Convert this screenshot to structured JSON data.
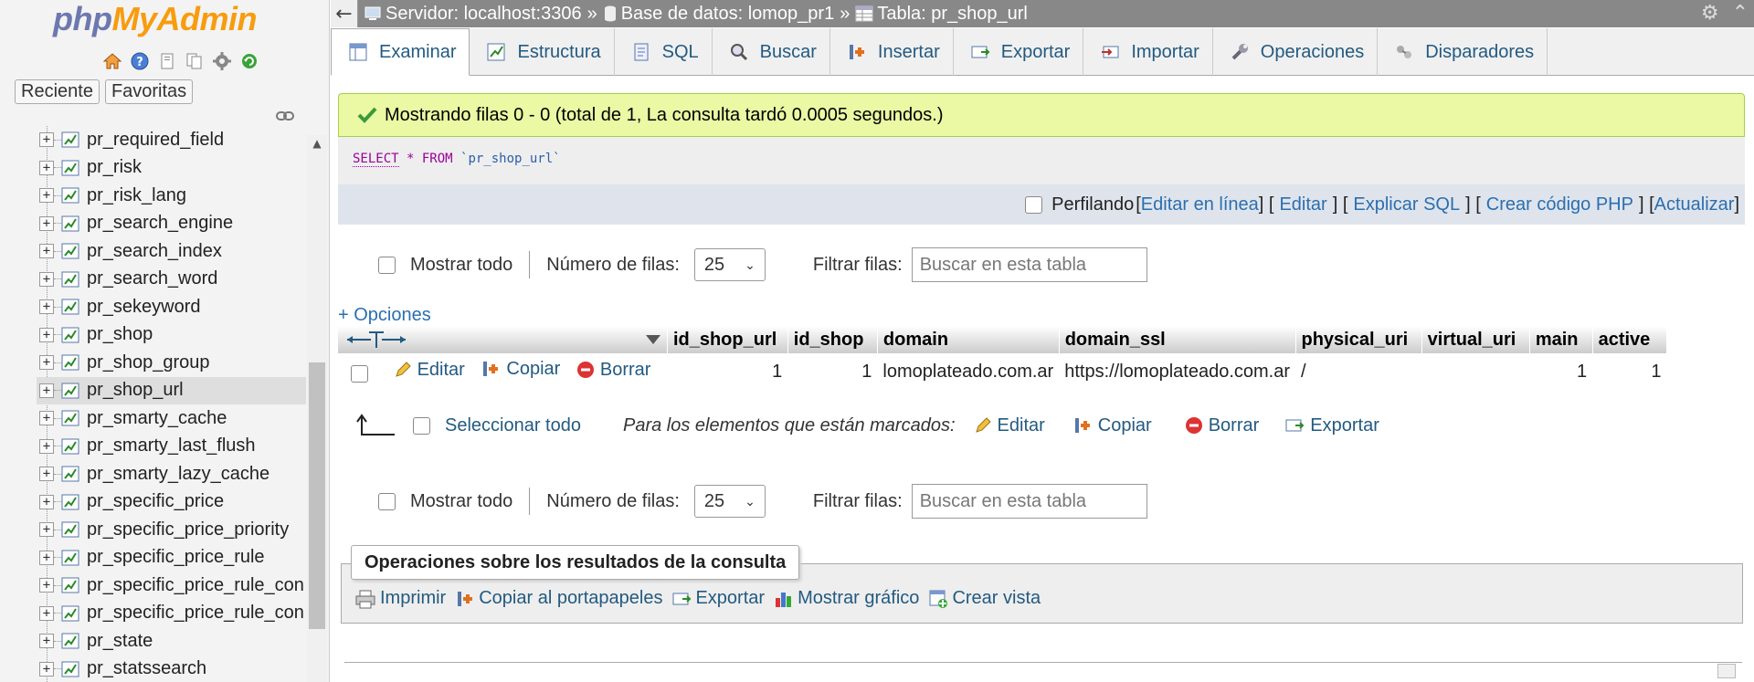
{
  "sidebar": {
    "logo_php": "php",
    "logo_myadmin": "MyAdmin",
    "tabs": [
      "Reciente",
      "Favoritas"
    ],
    "tables": [
      "pr_required_field",
      "pr_risk",
      "pr_risk_lang",
      "pr_search_engine",
      "pr_search_index",
      "pr_search_word",
      "pr_sekeyword",
      "pr_shop",
      "pr_shop_group",
      "pr_shop_url",
      "pr_smarty_cache",
      "pr_smarty_last_flush",
      "pr_smarty_lazy_cache",
      "pr_specific_price",
      "pr_specific_price_priority",
      "pr_specific_price_rule",
      "pr_specific_price_rule_con",
      "pr_specific_price_rule_con",
      "pr_state",
      "pr_statssearch"
    ],
    "selected_table": "pr_shop_url"
  },
  "breadcrumb": {
    "server": "Servidor: localhost:3306",
    "database": "Base de datos: lomop_pr1",
    "table": "Tabla: pr_shop_url",
    "sep": "»"
  },
  "tabs": [
    "Examinar",
    "Estructura",
    "SQL",
    "Buscar",
    "Insertar",
    "Exportar",
    "Importar",
    "Operaciones",
    "Disparadores"
  ],
  "message": "Mostrando filas 0 - 0 (total de 1, La consulta tardó 0.0005 segundos.)",
  "sql": {
    "select": "SELECT",
    "rest": " * FROM ",
    "table": "`pr_shop_url`"
  },
  "sql_links": {
    "profiling": "Perfilando",
    "items": [
      "Editar en línea",
      "Editar",
      "Explicar SQL",
      "Crear código PHP",
      "Actualizar"
    ]
  },
  "navigation": {
    "show_all": "Mostrar todo",
    "rows_label": "Número de filas:",
    "rows_value": "25",
    "filter_label": "Filtrar filas:",
    "filter_placeholder": "Buscar en esta tabla"
  },
  "options_link": "+ Opciones",
  "table": {
    "columns": [
      "id_shop_url",
      "id_shop",
      "domain",
      "domain_ssl",
      "physical_uri",
      "virtual_uri",
      "main",
      "active"
    ],
    "row": {
      "id_shop_url": "1",
      "id_shop": "1",
      "domain": "lomoplateado.com.ar",
      "domain_ssl": "https://lomoplateado.com.ar",
      "physical_uri": "/",
      "virtual_uri": "",
      "main": "1",
      "active": "1"
    },
    "actions": [
      "Editar",
      "Copiar",
      "Borrar"
    ]
  },
  "bulk": {
    "select_all": "Seleccionar todo",
    "marked": "Para los elementos que están marcados:",
    "actions": [
      "Editar",
      "Copiar",
      "Borrar",
      "Exportar"
    ]
  },
  "query_ops": {
    "title": "Operaciones sobre los resultados de la consulta",
    "items": [
      "Imprimir",
      "Copiar al portapapeles",
      "Exportar",
      "Mostrar gráfico",
      "Crear vista"
    ]
  },
  "colors": {
    "link": "#235a81",
    "success_bg": "#ebf8a4",
    "topbar": "#888888",
    "logo_php": "#6c78af",
    "logo_myadmin": "#f89c0e"
  }
}
